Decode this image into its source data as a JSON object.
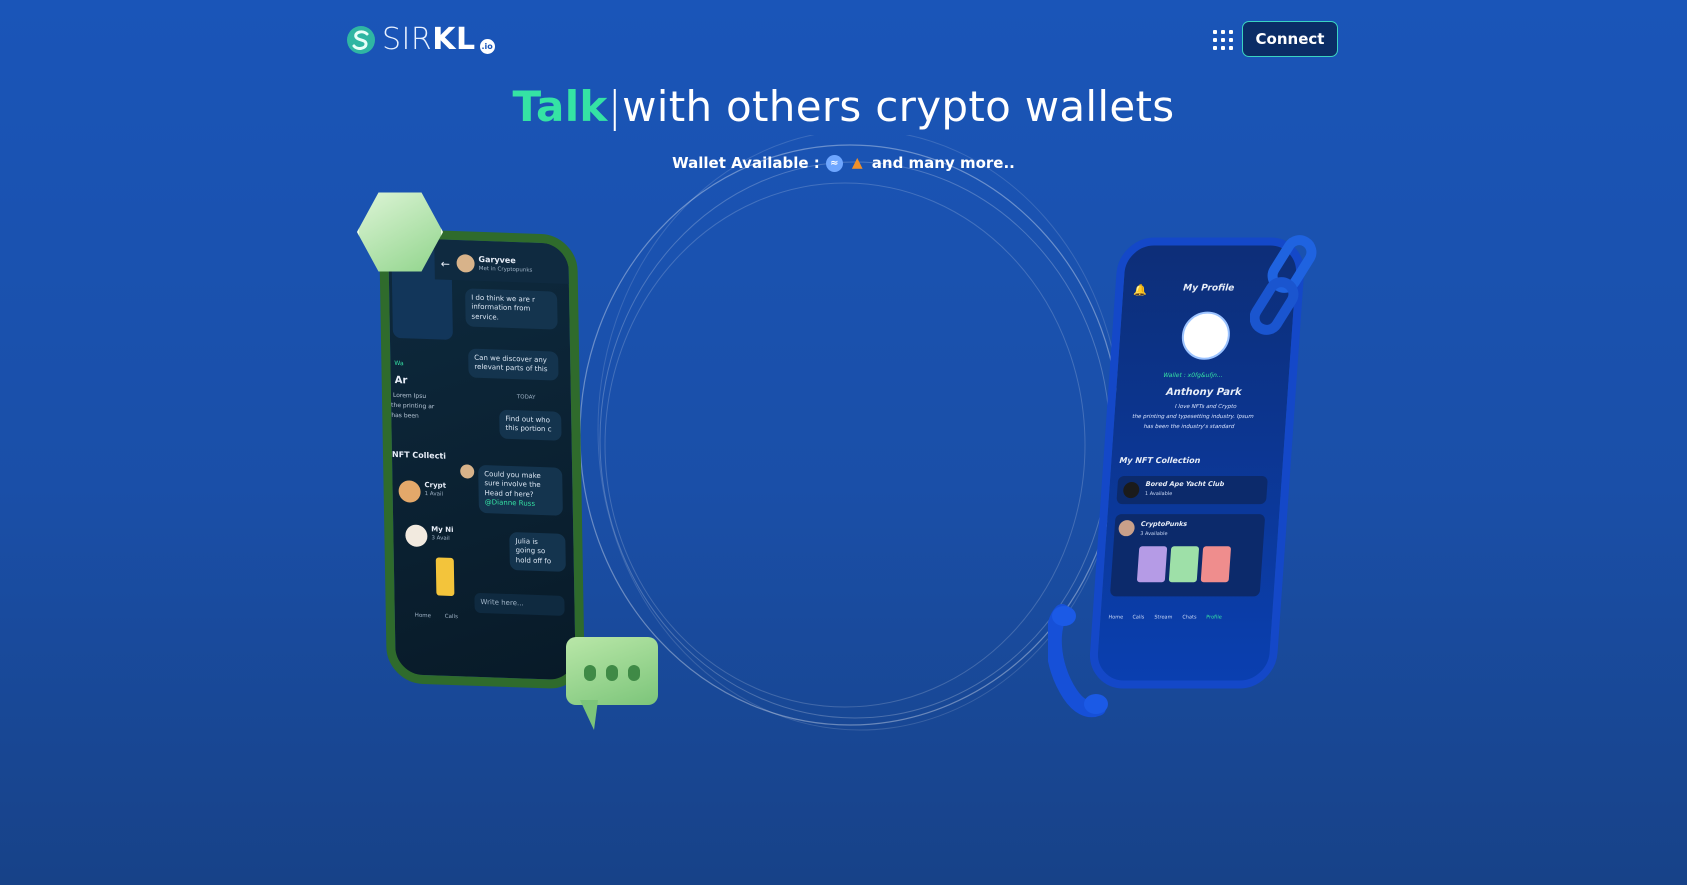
{
  "header": {
    "logo_prefix": "SIR",
    "logo_bold": "KL",
    "logo_suffix": ".io",
    "apps_icon": "grid-icon",
    "connect_label": "Connect"
  },
  "hero": {
    "highlight": "Talk",
    "cursor": "|",
    "rest": "with others crypto wallets",
    "wallets_label": "Wallet Available :",
    "wallets_more": "and many more..",
    "wallet_icons": [
      "wallet-blue-icon",
      "metamask-fox-icon"
    ]
  },
  "chat_phone": {
    "contact_name": "Garyvee",
    "contact_status": "Met in Cryptopunks",
    "messages": [
      "I do think we are r information from service.",
      "Can we discover any relevant parts of this",
      "Find out who this portion c",
      "Could you make sure involve the Head of here?",
      "Julia is going so hold off fo"
    ],
    "mention": "@Dianne Russ",
    "day_label": "TODAY",
    "input_placeholder": "Write here...",
    "profile_wallet": "Wa",
    "profile_name": "Ar",
    "profile_bio": [
      "Lorem Ipsu",
      "the printing ar",
      "has been"
    ],
    "collection_title": "NFT Collecti",
    "collection_items": [
      {
        "name": "Crypt",
        "count": "1 Avail"
      },
      {
        "name": "My Ni",
        "count": "3 Avail"
      }
    ],
    "nav": [
      "Home",
      "Calls"
    ]
  },
  "profile_phone": {
    "title": "My Profile",
    "wallet": "Wallet : x0fg&ufjn...",
    "name": "Anthony Park",
    "bio": [
      "I love NFTs and Crypto",
      "the printing and typesetting industry. Ipsum",
      "has been the industry's standard"
    ],
    "collection_title": "My NFT Collection",
    "collections": [
      {
        "name": "Bored Ape Yacht Club",
        "count": "1 Available"
      },
      {
        "name": "CryptoPunks",
        "count": "3 Available"
      }
    ],
    "nav": [
      "Home",
      "Calls",
      "Stream",
      "Chats",
      "Profile"
    ]
  },
  "colors": {
    "accent": "#35e3a4",
    "background": "#1a55b8",
    "connect_border": "#3ad4c2"
  }
}
